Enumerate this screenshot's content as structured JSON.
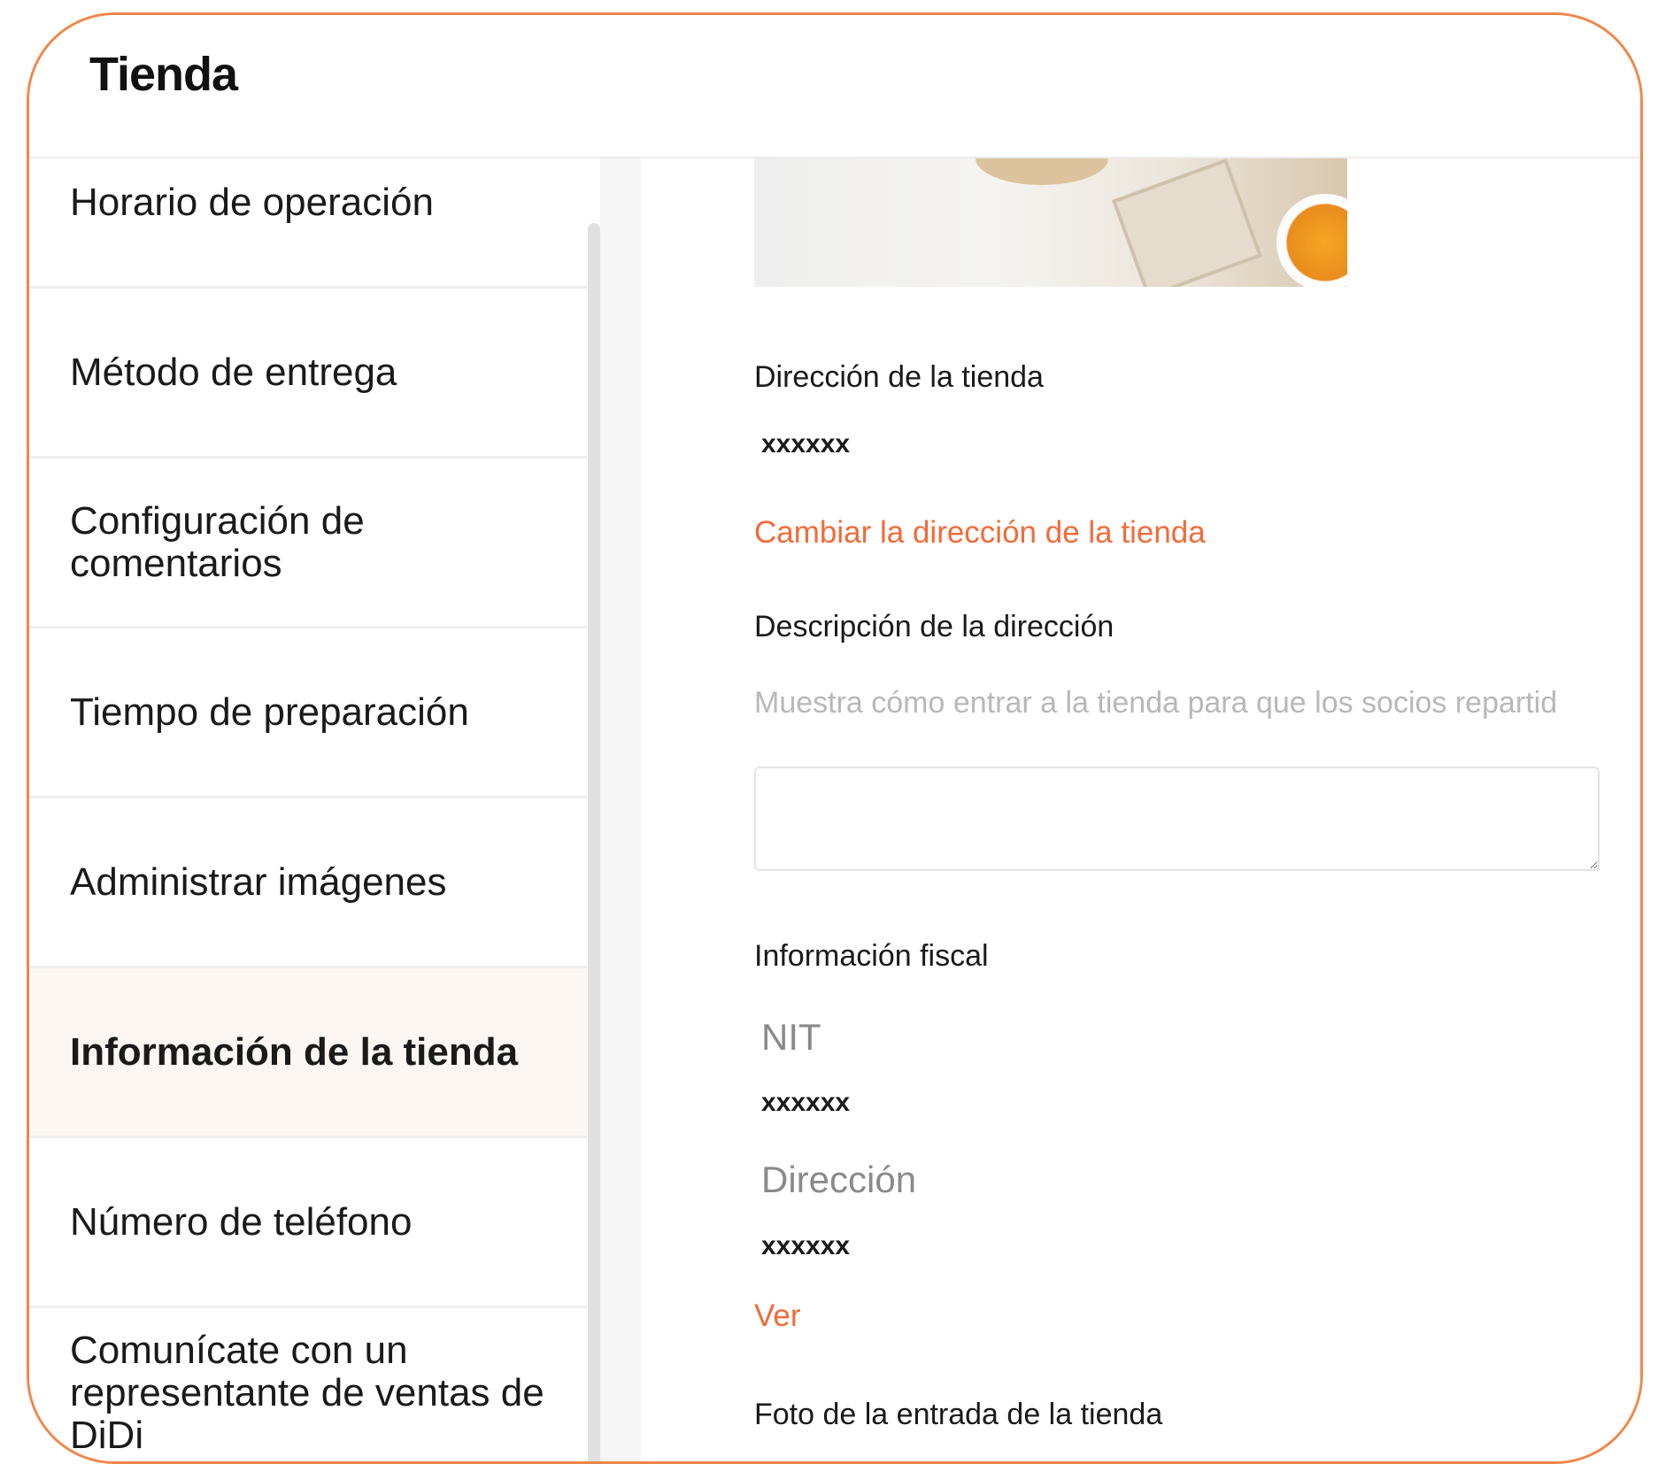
{
  "header": {
    "title": "Tienda"
  },
  "sidebar": {
    "items": [
      {
        "label": "Horario de operación",
        "active": false
      },
      {
        "label": "Método de entrega",
        "active": false
      },
      {
        "label": "Configuración de comentarios",
        "active": false
      },
      {
        "label": "Tiempo de preparación",
        "active": false
      },
      {
        "label": "Administrar imágenes",
        "active": false
      },
      {
        "label": "Información de la tienda",
        "active": true
      },
      {
        "label": "Número de teléfono",
        "active": false
      },
      {
        "label": "Comunícate con un representante de ventas de DiDi",
        "active": false
      }
    ]
  },
  "content": {
    "address": {
      "label": "Dirección de la tienda",
      "value": "xxxxxx",
      "change_link": "Cambiar la dirección de la tienda"
    },
    "address_description": {
      "label": "Descripción de la dirección",
      "hint": "Muestra cómo entrar a la tienda para que los socios repartid",
      "value": ""
    },
    "fiscal": {
      "label": "Información fiscal",
      "nit_label": "NIT",
      "nit_value": "xxxxxx",
      "address_label": "Dirección",
      "address_value": "xxxxxx",
      "view_link": "Ver"
    },
    "entrance_photo": {
      "label": "Foto de la entrada de la tienda"
    }
  },
  "colors": {
    "accent": "#f26b3a",
    "frame": "#f0874a",
    "active_bg": "#fdf7f3"
  }
}
